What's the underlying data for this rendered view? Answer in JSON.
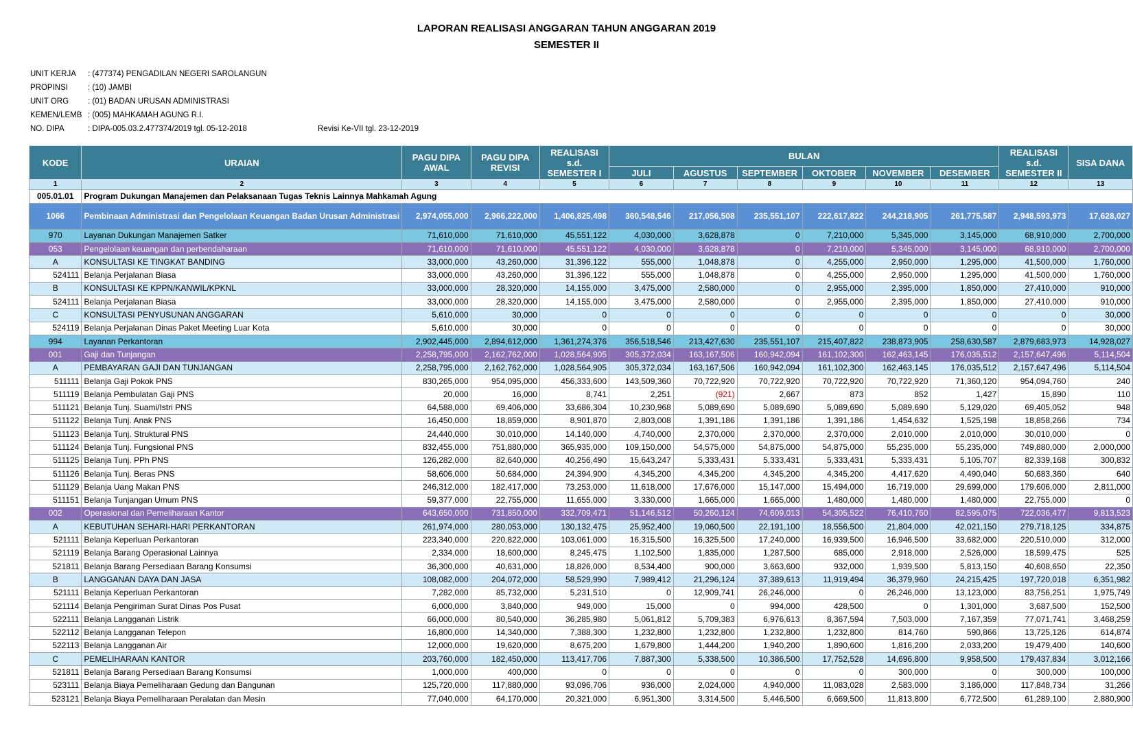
{
  "header": {
    "title": "LAPORAN REALISASI ANGGARAN TAHUN ANGGARAN 2019",
    "subtitle": "SEMESTER II"
  },
  "info": [
    {
      "label": "UNIT KERJA",
      "value": ": (477374) PENGADILAN NEGERI SAROLANGUN",
      "extra": ""
    },
    {
      "label": "PROPINSI",
      "value": ": (10) JAMBI",
      "extra": ""
    },
    {
      "label": "UNIT ORG",
      "value": ": (01) BADAN URUSAN ADMINISTRASI",
      "extra": ""
    },
    {
      "label": "KEMEN/LEMB",
      "value": ": (005) MAHKAMAH AGUNG R.I.",
      "extra": ""
    },
    {
      "label": "NO. DIPA",
      "value": ": DIPA-005.03.2.477374/2019 tgl. 05-12-2018",
      "extra": "Revisi Ke-VII tgl. 23-12-2019"
    }
  ],
  "table": {
    "headers": {
      "kode": "KODE",
      "uraian": "URAIAN",
      "pagu_awal": "PAGU DIPA AWAL",
      "pagu_revisi": "PAGU DIPA REVISI",
      "real_sem1": "REALISASI s.d. SEMESTER I",
      "bulan": "BULAN",
      "months": [
        "JULI",
        "AGUSTUS",
        "SEPTEMBER",
        "OKTOBER",
        "NOVEMBER",
        "DESEMBER"
      ],
      "real_sem2": "REALISASI s.d. SEMESTER II",
      "sisa": "SISA DANA"
    },
    "col_numbers": [
      "1",
      "2",
      "3",
      "4",
      "5",
      "6",
      "7",
      "8",
      "9",
      "10",
      "11",
      "12",
      "13"
    ],
    "program": {
      "kode": "005.01.01",
      "uraian": "Program Dukungan Manajemen dan Pelaksanaan Tugas Teknis Lainnya Mahkamah Agung"
    },
    "rows": [
      {
        "lvl": 1,
        "kode": "1066",
        "uraian": "Pembinaan Administrasi dan Pengelolaan Keuangan Badan Urusan Administrasi",
        "v": [
          "2,974,055,000",
          "2,966,222,000",
          "1,406,825,498",
          "360,548,546",
          "217,056,508",
          "235,551,107",
          "222,617,822",
          "244,218,905",
          "261,775,587",
          "2,948,593,973",
          "17,628,027"
        ]
      },
      {
        "lvl": 2,
        "kode": "970",
        "uraian": "Layanan Dukungan Manajemen Satker",
        "v": [
          "71,610,000",
          "71,610,000",
          "45,551,122",
          "4,030,000",
          "3,628,878",
          "0",
          "7,210,000",
          "5,345,000",
          "3,145,000",
          "68,910,000",
          "2,700,000"
        ]
      },
      {
        "lvl": 3,
        "kode": "053",
        "uraian": "Pengelolaan keuangan dan perbendaharaan",
        "v": [
          "71,610,000",
          "71,610,000",
          "45,551,122",
          "4,030,000",
          "3,628,878",
          "0",
          "7,210,000",
          "5,345,000",
          "3,145,000",
          "68,910,000",
          "2,700,000"
        ]
      },
      {
        "lvl": 4,
        "kode": "A",
        "uraian": "KONSULTASI KE TINGKAT BANDING",
        "v": [
          "33,000,000",
          "43,260,000",
          "31,396,122",
          "555,000",
          "1,048,878",
          "0",
          "4,255,000",
          "2,950,000",
          "1,295,000",
          "41,500,000",
          "1,760,000"
        ]
      },
      {
        "lvl": 5,
        "kode": "524111",
        "uraian": "Belanja Perjalanan Biasa",
        "v": [
          "33,000,000",
          "43,260,000",
          "31,396,122",
          "555,000",
          "1,048,878",
          "0",
          "4,255,000",
          "2,950,000",
          "1,295,000",
          "41,500,000",
          "1,760,000"
        ]
      },
      {
        "lvl": 4,
        "kode": "B",
        "uraian": "KONSULTASI KE KPPN/KANWIL/KPKNL",
        "v": [
          "33,000,000",
          "28,320,000",
          "14,155,000",
          "3,475,000",
          "2,580,000",
          "0",
          "2,955,000",
          "2,395,000",
          "1,850,000",
          "27,410,000",
          "910,000"
        ]
      },
      {
        "lvl": 5,
        "kode": "524111",
        "uraian": "Belanja Perjalanan Biasa",
        "v": [
          "33,000,000",
          "28,320,000",
          "14,155,000",
          "3,475,000",
          "2,580,000",
          "0",
          "2,955,000",
          "2,395,000",
          "1,850,000",
          "27,410,000",
          "910,000"
        ]
      },
      {
        "lvl": 4,
        "kode": "C",
        "uraian": "KONSULTASI PENYUSUNAN ANGGARAN",
        "v": [
          "5,610,000",
          "30,000",
          "0",
          "0",
          "0",
          "0",
          "0",
          "0",
          "0",
          "0",
          "30,000"
        ]
      },
      {
        "lvl": 5,
        "kode": "524119",
        "uraian": "Belanja Perjalanan Dinas Paket Meeting Luar Kota",
        "v": [
          "5,610,000",
          "30,000",
          "0",
          "0",
          "0",
          "0",
          "0",
          "0",
          "0",
          "0",
          "30,000"
        ]
      },
      {
        "lvl": 2,
        "kode": "994",
        "uraian": "Layanan Perkantoran",
        "v": [
          "2,902,445,000",
          "2,894,612,000",
          "1,361,274,376",
          "356,518,546",
          "213,427,630",
          "235,551,107",
          "215,407,822",
          "238,873,905",
          "258,630,587",
          "2,879,683,973",
          "14,928,027"
        ]
      },
      {
        "lvl": 3,
        "kode": "001",
        "uraian": "Gaji dan Tunjangan",
        "v": [
          "2,258,795,000",
          "2,162,762,000",
          "1,028,564,905",
          "305,372,034",
          "163,167,506",
          "160,942,094",
          "161,102,300",
          "162,463,145",
          "176,035,512",
          "2,157,647,496",
          "5,114,504"
        ]
      },
      {
        "lvl": 4,
        "kode": "A",
        "uraian": "PEMBAYARAN GAJI DAN TUNJANGAN",
        "v": [
          "2,258,795,000",
          "2,162,762,000",
          "1,028,564,905",
          "305,372,034",
          "163,167,506",
          "160,942,094",
          "161,102,300",
          "162,463,145",
          "176,035,512",
          "2,157,647,496",
          "5,114,504"
        ]
      },
      {
        "lvl": 5,
        "kode": "511111",
        "uraian": "Belanja Gaji Pokok PNS",
        "v": [
          "830,265,000",
          "954,095,000",
          "456,333,600",
          "143,509,360",
          "70,722,920",
          "70,722,920",
          "70,722,920",
          "70,722,920",
          "71,360,120",
          "954,094,760",
          "240"
        ]
      },
      {
        "lvl": 5,
        "kode": "511119",
        "uraian": "Belanja Pembulatan Gaji PNS",
        "v": [
          "20,000",
          "16,000",
          "8,741",
          "2,251",
          "(921)",
          "2,667",
          "873",
          "852",
          "1,427",
          "15,890",
          "110"
        ]
      },
      {
        "lvl": 5,
        "kode": "511121",
        "uraian": "Belanja Tunj. Suami/Istri PNS",
        "v": [
          "64,588,000",
          "69,406,000",
          "33,686,304",
          "10,230,968",
          "5,089,690",
          "5,089,690",
          "5,089,690",
          "5,089,690",
          "5,129,020",
          "69,405,052",
          "948"
        ]
      },
      {
        "lvl": 5,
        "kode": "511122",
        "uraian": "Belanja Tunj. Anak PNS",
        "v": [
          "16,450,000",
          "18,859,000",
          "8,901,870",
          "2,803,008",
          "1,391,186",
          "1,391,186",
          "1,391,186",
          "1,454,632",
          "1,525,198",
          "18,858,266",
          "734"
        ]
      },
      {
        "lvl": 5,
        "kode": "511123",
        "uraian": "Belanja Tunj. Struktural PNS",
        "v": [
          "24,440,000",
          "30,010,000",
          "14,140,000",
          "4,740,000",
          "2,370,000",
          "2,370,000",
          "2,370,000",
          "2,010,000",
          "2,010,000",
          "30,010,000",
          "0"
        ]
      },
      {
        "lvl": 5,
        "kode": "511124",
        "uraian": "Belanja Tunj. Fungsional PNS",
        "v": [
          "832,455,000",
          "751,880,000",
          "365,935,000",
          "109,150,000",
          "54,575,000",
          "54,875,000",
          "54,875,000",
          "55,235,000",
          "55,235,000",
          "749,880,000",
          "2,000,000"
        ]
      },
      {
        "lvl": 5,
        "kode": "511125",
        "uraian": "Belanja Tunj. PPh PNS",
        "v": [
          "126,282,000",
          "82,640,000",
          "40,256,490",
          "15,643,247",
          "5,333,431",
          "5,333,431",
          "5,333,431",
          "5,333,431",
          "5,105,707",
          "82,339,168",
          "300,832"
        ]
      },
      {
        "lvl": 5,
        "kode": "511126",
        "uraian": "Belanja Tunj. Beras PNS",
        "v": [
          "58,606,000",
          "50,684,000",
          "24,394,900",
          "4,345,200",
          "4,345,200",
          "4,345,200",
          "4,345,200",
          "4,417,620",
          "4,490,040",
          "50,683,360",
          "640"
        ]
      },
      {
        "lvl": 5,
        "kode": "511129",
        "uraian": "Belanja Uang Makan PNS",
        "v": [
          "246,312,000",
          "182,417,000",
          "73,253,000",
          "11,618,000",
          "17,676,000",
          "15,147,000",
          "15,494,000",
          "16,719,000",
          "29,699,000",
          "179,606,000",
          "2,811,000"
        ]
      },
      {
        "lvl": 5,
        "kode": "511151",
        "uraian": "Belanja Tunjangan Umum PNS",
        "v": [
          "59,377,000",
          "22,755,000",
          "11,655,000",
          "3,330,000",
          "1,665,000",
          "1,665,000",
          "1,480,000",
          "1,480,000",
          "1,480,000",
          "22,755,000",
          "0"
        ]
      },
      {
        "lvl": 3,
        "kode": "002",
        "uraian": "Operasional dan Pemeliharaan Kantor",
        "v": [
          "643,650,000",
          "731,850,000",
          "332,709,471",
          "51,146,512",
          "50,260,124",
          "74,609,013",
          "54,305,522",
          "76,410,760",
          "82,595,075",
          "722,036,477",
          "9,813,523"
        ]
      },
      {
        "lvl": 4,
        "kode": "A",
        "uraian": "KEBUTUHAN SEHARI-HARI PERKANTORAN",
        "v": [
          "261,974,000",
          "280,053,000",
          "130,132,475",
          "25,952,400",
          "19,060,500",
          "22,191,100",
          "18,556,500",
          "21,804,000",
          "42,021,150",
          "279,718,125",
          "334,875"
        ]
      },
      {
        "lvl": 5,
        "kode": "521111",
        "uraian": "Belanja Keperluan Perkantoran",
        "v": [
          "223,340,000",
          "220,822,000",
          "103,061,000",
          "16,315,500",
          "16,325,500",
          "17,240,000",
          "16,939,500",
          "16,946,500",
          "33,682,000",
          "220,510,000",
          "312,000"
        ]
      },
      {
        "lvl": 5,
        "kode": "521119",
        "uraian": "Belanja Barang Operasional Lainnya",
        "v": [
          "2,334,000",
          "18,600,000",
          "8,245,475",
          "1,102,500",
          "1,835,000",
          "1,287,500",
          "685,000",
          "2,918,000",
          "2,526,000",
          "18,599,475",
          "525"
        ]
      },
      {
        "lvl": 5,
        "kode": "521811",
        "uraian": "Belanja Barang Persediaan Barang Konsumsi",
        "v": [
          "36,300,000",
          "40,631,000",
          "18,826,000",
          "8,534,400",
          "900,000",
          "3,663,600",
          "932,000",
          "1,939,500",
          "5,813,150",
          "40,608,650",
          "22,350"
        ]
      },
      {
        "lvl": 4,
        "kode": "B",
        "uraian": "LANGGANAN DAYA DAN JASA",
        "v": [
          "108,082,000",
          "204,072,000",
          "58,529,990",
          "7,989,412",
          "21,296,124",
          "37,389,613",
          "11,919,494",
          "36,379,960",
          "24,215,425",
          "197,720,018",
          "6,351,982"
        ]
      },
      {
        "lvl": 5,
        "kode": "521111",
        "uraian": "Belanja Keperluan Perkantoran",
        "v": [
          "7,282,000",
          "85,732,000",
          "5,231,510",
          "0",
          "12,909,741",
          "26,246,000",
          "0",
          "26,246,000",
          "13,123,000",
          "83,756,251",
          "1,975,749"
        ]
      },
      {
        "lvl": 5,
        "kode": "521114",
        "uraian": "Belanja Pengiriman Surat Dinas Pos Pusat",
        "v": [
          "6,000,000",
          "3,840,000",
          "949,000",
          "15,000",
          "0",
          "994,000",
          "428,500",
          "0",
          "1,301,000",
          "3,687,500",
          "152,500"
        ]
      },
      {
        "lvl": 5,
        "kode": "522111",
        "uraian": "Belanja Langganan Listrik",
        "v": [
          "66,000,000",
          "80,540,000",
          "36,285,980",
          "5,061,812",
          "5,709,383",
          "6,976,613",
          "8,367,594",
          "7,503,000",
          "7,167,359",
          "77,071,741",
          "3,468,259"
        ]
      },
      {
        "lvl": 5,
        "kode": "522112",
        "uraian": "Belanja Langganan Telepon",
        "v": [
          "16,800,000",
          "14,340,000",
          "7,388,300",
          "1,232,800",
          "1,232,800",
          "1,232,800",
          "1,232,800",
          "814,760",
          "590,866",
          "13,725,126",
          "614,874"
        ]
      },
      {
        "lvl": 5,
        "kode": "522113",
        "uraian": "Belanja Langganan Air",
        "v": [
          "12,000,000",
          "19,620,000",
          "8,675,200",
          "1,679,800",
          "1,444,200",
          "1,940,200",
          "1,890,600",
          "1,816,200",
          "2,033,200",
          "19,479,400",
          "140,600"
        ]
      },
      {
        "lvl": 4,
        "kode": "C",
        "uraian": "PEMELIHARAAN KANTOR",
        "v": [
          "203,760,000",
          "182,450,000",
          "113,417,706",
          "7,887,300",
          "5,338,500",
          "10,386,500",
          "17,752,528",
          "14,696,800",
          "9,958,500",
          "179,437,834",
          "3,012,166"
        ]
      },
      {
        "lvl": 5,
        "kode": "521811",
        "uraian": "Belanja Barang Persediaan Barang Konsumsi",
        "v": [
          "1,000,000",
          "400,000",
          "0",
          "0",
          "0",
          "0",
          "0",
          "300,000",
          "0",
          "300,000",
          "100,000"
        ]
      },
      {
        "lvl": 5,
        "kode": "523111",
        "uraian": "Belanja Biaya Pemeliharaan Gedung dan Bangunan",
        "v": [
          "125,720,000",
          "117,880,000",
          "93,096,706",
          "936,000",
          "2,024,000",
          "4,940,000",
          "11,083,028",
          "2,583,000",
          "3,186,000",
          "117,848,734",
          "31,266"
        ]
      },
      {
        "lvl": 5,
        "kode": "523121",
        "uraian": "Belanja Biaya Pemeliharaan Peralatan dan Mesin",
        "v": [
          "77,040,000",
          "64,170,000",
          "20,321,000",
          "6,951,300",
          "3,314,500",
          "5,446,500",
          "6,669,500",
          "11,813,800",
          "6,772,500",
          "61,289,100",
          "2,880,900"
        ]
      }
    ]
  }
}
